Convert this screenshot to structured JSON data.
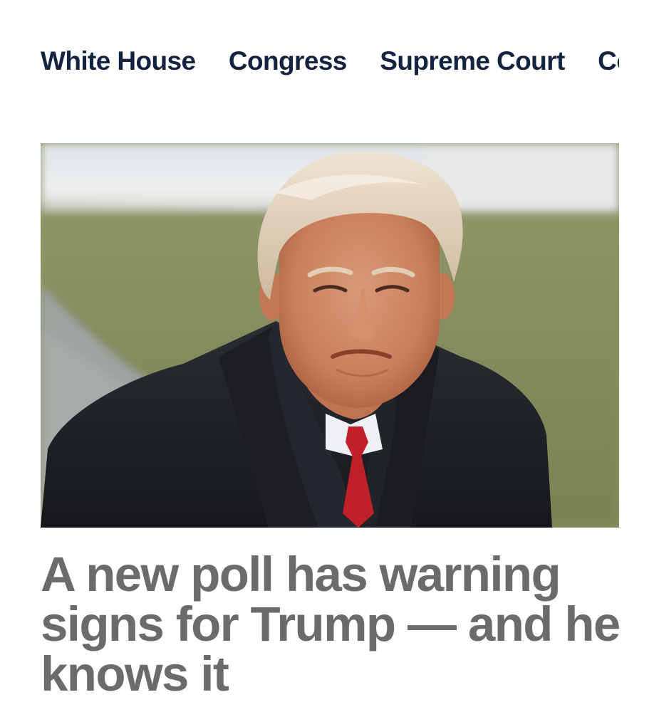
{
  "nav": {
    "items": [
      {
        "label": "White House"
      },
      {
        "label": "Congress"
      },
      {
        "label": "Supreme Court"
      },
      {
        "label": "Courts"
      }
    ]
  },
  "article": {
    "headline": "A new poll has warning signs for Trump — and he knows it"
  }
}
